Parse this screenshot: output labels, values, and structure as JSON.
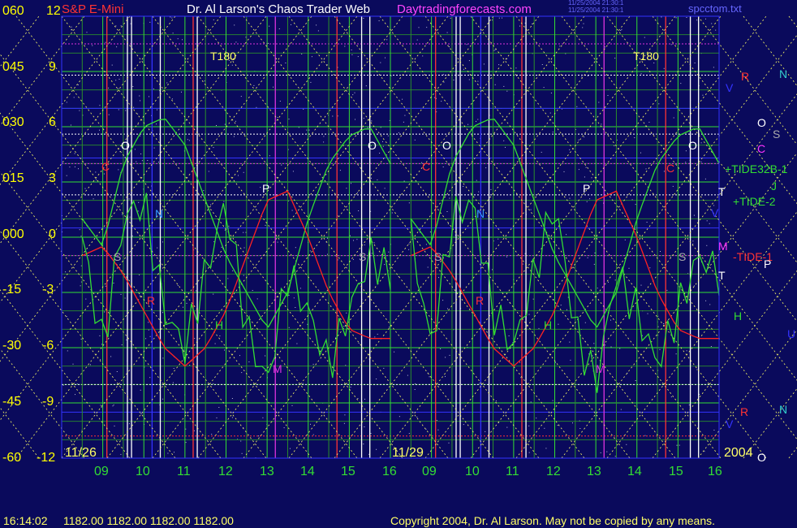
{
  "header": {
    "symbol": "S&P E-Mini",
    "author": "Dr. Al Larson's Chaos Trader Web",
    "site": "Daytradingforecasts.com",
    "stamp1": "11/25/2004 21:30:1",
    "stamp2": "11/25/2004 21:30:1",
    "filename": "spcctom.txt"
  },
  "footer": {
    "time_readout": "16:14:02",
    "ohlc_readout": "1182.00 1182.00 1182.00 1182.00",
    "copyright": "Copyright 2004, Dr. Al Larson. May not be copied by any means."
  },
  "axes": {
    "left_outer": [
      "060",
      "045",
      "030",
      "015",
      "000",
      "-15",
      "-30",
      "-45",
      "-60"
    ],
    "left_inner": [
      "12",
      "9",
      "6",
      "3",
      "0",
      "-3",
      "-6",
      "-9",
      "-12"
    ],
    "x_ticks": [
      "09",
      "10",
      "11",
      "12",
      "13",
      "14",
      "15",
      "16",
      "09",
      "10",
      "11",
      "12",
      "13",
      "14",
      "15",
      "16"
    ],
    "date_left": "11/26",
    "date_mid": "11/29",
    "year": "2004"
  },
  "right_labels": {
    "r1": "R",
    "n1": "N",
    "v1": "V",
    "o": "O",
    "s": "S",
    "c": "C",
    "tide32": "+TIDE32B-1",
    "j": "J",
    "t1": "T",
    "tide2": "+TIDE-2",
    "v2": "V",
    "m": "M",
    "tide1": "-TIDE-1",
    "p": "P",
    "t2": "T",
    "h": "H",
    "u": "U",
    "r2": "R",
    "n2": "N",
    "v3": "V",
    "o2": "O"
  },
  "markers": {
    "t180": "T180",
    "o": "O",
    "c": "C",
    "n": "N",
    "s": "S",
    "p": "P",
    "h": "H",
    "m": "M",
    "r": "R"
  },
  "colors": {
    "background": "#0a0a5c",
    "grid_yellow": "#ffff66",
    "green": "#33dd33",
    "red": "#ff2222",
    "magenta": "#dd33dd",
    "blue": "#3333ff",
    "white": "#ffffff"
  },
  "chart_data": {
    "type": "line",
    "title": "S&P E-Mini",
    "x_days": [
      "11/26",
      "11/29"
    ],
    "x_hours": [
      9,
      10,
      11,
      12,
      13,
      14,
      15,
      16
    ],
    "ylim_outer": [
      -60,
      60
    ],
    "ylim_inner": [
      -12,
      12
    ],
    "series": [
      {
        "name": "+TIDE-2",
        "color": "#33dd33",
        "x": [
          8.5,
          9,
          9.5,
          10,
          10.5,
          11,
          11.5,
          12,
          12.5,
          13,
          13.5,
          14,
          14.5,
          15,
          15.5,
          16
        ],
        "y": [
          1,
          -0.5,
          4,
          6,
          6.5,
          5,
          2,
          -1,
          -3,
          -5,
          -3,
          1,
          4,
          5.5,
          6,
          4
        ]
      },
      {
        "name": "-TIDE-1",
        "color": "#ff2222",
        "x": [
          8.5,
          9,
          9.5,
          10,
          10.5,
          11,
          11.5,
          12,
          12.5,
          13,
          13.5,
          14,
          14.5,
          15,
          15.5,
          16
        ],
        "y": [
          -1,
          -0.5,
          -2,
          -4,
          -6,
          -7,
          -6,
          -4,
          -1,
          2,
          2.5,
          0,
          -3,
          -5,
          -5.5,
          -5.5
        ]
      },
      {
        "name": "+TIDE32B-1",
        "color": "#33dd33",
        "x": [
          8.5,
          9,
          9.5,
          10,
          10.5,
          11,
          11.5,
          12,
          12.5,
          13,
          13.5,
          14,
          14.5,
          15,
          15.5,
          16
        ],
        "y": [
          0,
          -6,
          1,
          2,
          -4,
          -6,
          -2,
          2,
          -5,
          -8,
          -2,
          -4,
          -7,
          -4,
          -1,
          -2
        ]
      }
    ]
  }
}
